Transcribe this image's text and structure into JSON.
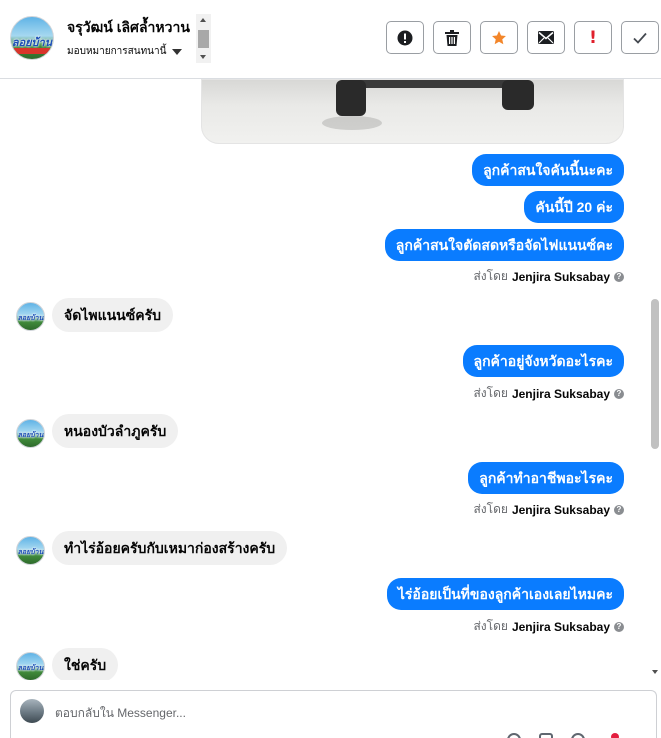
{
  "header": {
    "name": "จรุวัฒน์ เลิศล้ำหวาน",
    "assign_label": "มอบหมายการสนทนานี้",
    "avatar_text": "ลอยบ้าน"
  },
  "toolbar": {
    "buttons": [
      {
        "id": "spam",
        "icon": "alert-circle-icon"
      },
      {
        "id": "delete",
        "icon": "trash-icon"
      },
      {
        "id": "star",
        "icon": "star-icon"
      },
      {
        "id": "mark-unread",
        "icon": "envelope-icon"
      },
      {
        "id": "follow-up",
        "icon": "exclamation-icon",
        "glyph": "!"
      },
      {
        "id": "done",
        "icon": "check-icon"
      }
    ],
    "colors": {
      "star": "#f3862a",
      "follow_up": "#e0202c"
    }
  },
  "messages": [
    {
      "dir": "out",
      "text": "ลูกค้าสนใจคันนี้นะคะ"
    },
    {
      "dir": "out",
      "text": "คันนี้ปี 20 ค่ะ"
    },
    {
      "dir": "out",
      "text": "ลูกค้าสนใจตัดสดหรือจัดไฟแนนซ์คะ"
    },
    {
      "dir": "in",
      "text": "จัดไพแนนซ์ครับ"
    },
    {
      "dir": "out",
      "text": "ลูกค้าอยู่จังหวัดอะไรคะ"
    },
    {
      "dir": "in",
      "text": "หนองบัวลำภูครับ"
    },
    {
      "dir": "out",
      "text": "ลูกค้าทำอาชีพอะไรคะ"
    },
    {
      "dir": "in",
      "text": "ทำไร่อ้อยครับกับเหมาก่องสร้างครับ"
    },
    {
      "dir": "out",
      "text": "ไร่อ้อยเป็นที่ของลูกค้าเองเลยไหมคะ"
    },
    {
      "dir": "in",
      "text": "ใช่ครับ"
    }
  ],
  "sent_by": {
    "prefix": "ส่งโดย",
    "sender": "Jenjira Suksabay",
    "help": "?"
  },
  "composer": {
    "placeholder": "ตอบกลับใน Messenger..."
  },
  "colors": {
    "outgoing_bubble": "#0a7cff",
    "incoming_bubble": "#f0f0f0"
  }
}
